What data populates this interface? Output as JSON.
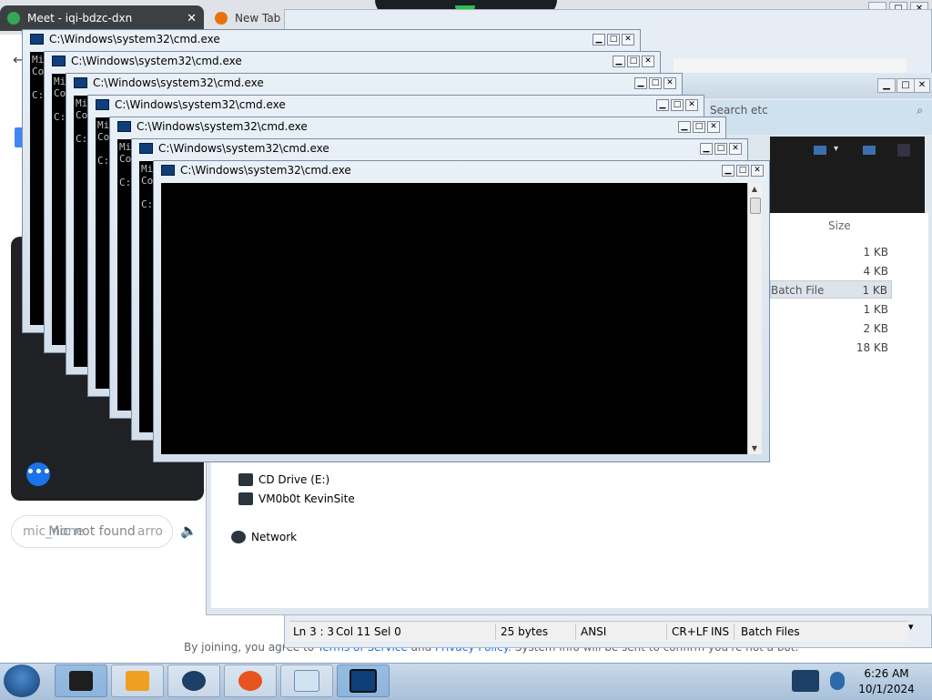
{
  "browser": {
    "active_tab": "Meet - iqi-bdzc-dxn",
    "inactive_tab": "New Tab",
    "mic_status": "mic_none",
    "mic_overlay": "Mic not found",
    "mic_suffix": "arro",
    "join_notice_prefix": "By joining, you agree to ",
    "terms_link": "Terms of Service",
    "join_and": " and ",
    "privacy_link": "Privacy Policy",
    "join_notice_suffix": ". System info will be sent to confirm you're not a bot.",
    "more_options_icon": "•••"
  },
  "explorer": {
    "search_placeholder": "Search etc",
    "column_size": "Size",
    "files": [
      {
        "type": "",
        "size": "1 KB"
      },
      {
        "type": "",
        "size": "4 KB"
      },
      {
        "type": "Batch File",
        "size": "1 KB",
        "selected": true
      },
      {
        "type": "",
        "size": "1 KB"
      },
      {
        "type": "",
        "size": "2 KB"
      },
      {
        "type": "",
        "size": "18 KB"
      }
    ],
    "nav": [
      {
        "label": "CD Drive (E:)",
        "icon": "cd-drive-icon"
      },
      {
        "label": "VM0b0t KevinSite",
        "icon": "network-drive-icon"
      },
      {
        "label": "Network",
        "icon": "network-icon"
      }
    ]
  },
  "notepad_status": {
    "position": "Ln 3 : 3",
    "column": "Col 11",
    "selection": "Sel 0",
    "size": "25 bytes",
    "encoding": "ANSI",
    "line_ending": "CR+LF",
    "mode": "INS",
    "file_type": "Batch Files"
  },
  "cmd_windows": [
    {
      "title": "C:\\Windows\\system32\\cmd.exe",
      "lines": [
        "Mi",
        "Co",
        "",
        "C:"
      ]
    },
    {
      "title": "C:\\Windows\\system32\\cmd.exe",
      "lines": [
        "Mi",
        "Co",
        "",
        "C:"
      ]
    },
    {
      "title": "C:\\Windows\\system32\\cmd.exe",
      "lines": [
        "Mi",
        "Co",
        "",
        "C:"
      ]
    },
    {
      "title": "C:\\Windows\\system32\\cmd.exe",
      "lines": [
        "Mi",
        "Co",
        "",
        "C:"
      ]
    },
    {
      "title": "C:\\Windows\\system32\\cmd.exe",
      "lines": [
        "Mi",
        "Co",
        "",
        "C:"
      ]
    },
    {
      "title": "C:\\Windows\\system32\\cmd.exe",
      "lines": [
        "Mi",
        "Co",
        "",
        "C:"
      ]
    },
    {
      "title": "C:\\Windows\\system32\\cmd.exe",
      "lines": []
    }
  ],
  "taskbar": {
    "time": "6:26 AM",
    "date": "10/1/2024",
    "apps": [
      {
        "icon": "virtual-machine-icon",
        "active": true
      },
      {
        "icon": "media-player-icon",
        "active": false
      },
      {
        "icon": "browser-globe-icon",
        "active": false
      },
      {
        "icon": "firefox-icon",
        "active": false
      },
      {
        "icon": "notepad-icon",
        "active": false
      },
      {
        "icon": "cmd-icon",
        "active": true
      }
    ]
  }
}
